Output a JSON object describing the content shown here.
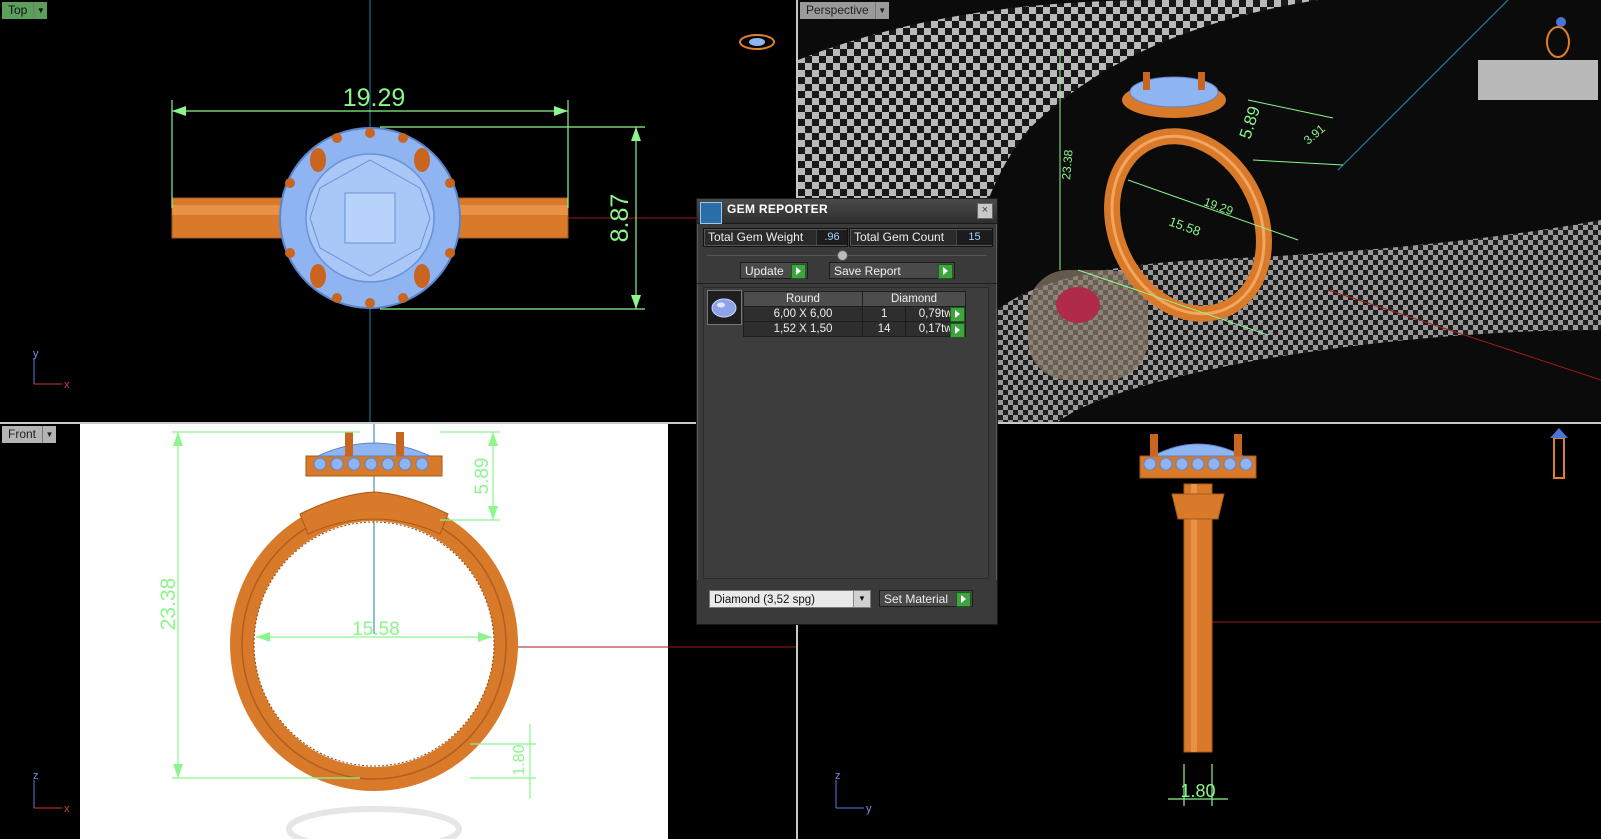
{
  "viewports": {
    "top": {
      "label": "Top",
      "dimensions": {
        "width": "19.29",
        "height": "8.87"
      },
      "axes": {
        "vertical": "y",
        "horizontal": "x"
      }
    },
    "perspective": {
      "label": "Perspective",
      "dimensions": {
        "top_height": "5.89",
        "top_width": "3.91",
        "diameter": "19.29",
        "inner": "15.58",
        "overall": "23.38"
      }
    },
    "front": {
      "label": "Front",
      "dimensions": {
        "overall_height": "23.38",
        "inner_diameter": "15.58",
        "head_height": "5.89",
        "band_thickness": "1.80"
      },
      "axes": {
        "vertical": "z",
        "horizontal": "x"
      }
    },
    "side": {
      "dimensions": {
        "band_width": "1.80"
      },
      "axes": {
        "vertical": "z",
        "horizontal": "y"
      }
    }
  },
  "gem_reporter": {
    "title": "GEM REPORTER",
    "close_label": "×",
    "total_weight_label": "Total Gem Weight",
    "total_weight_value": ".96",
    "total_count_label": "Total Gem Count",
    "total_count_value": "15",
    "update_label": "Update",
    "save_report_label": "Save Report",
    "table": {
      "headers": [
        "Round",
        "Diamond"
      ],
      "rows": [
        {
          "size": "6,00 X 6,00",
          "count": "1",
          "weight": "0,79tw"
        },
        {
          "size": "1,52 X 1,50",
          "count": "14",
          "weight": "0,17tw"
        }
      ]
    },
    "material_selected": "Diamond     (3,52 spg)",
    "set_material_label": "Set Material"
  },
  "colors": {
    "metal": "#d9792a",
    "gem": "#8fb4f2",
    "dimension": "#8cf58c",
    "accent_play": "#3fa33f"
  }
}
